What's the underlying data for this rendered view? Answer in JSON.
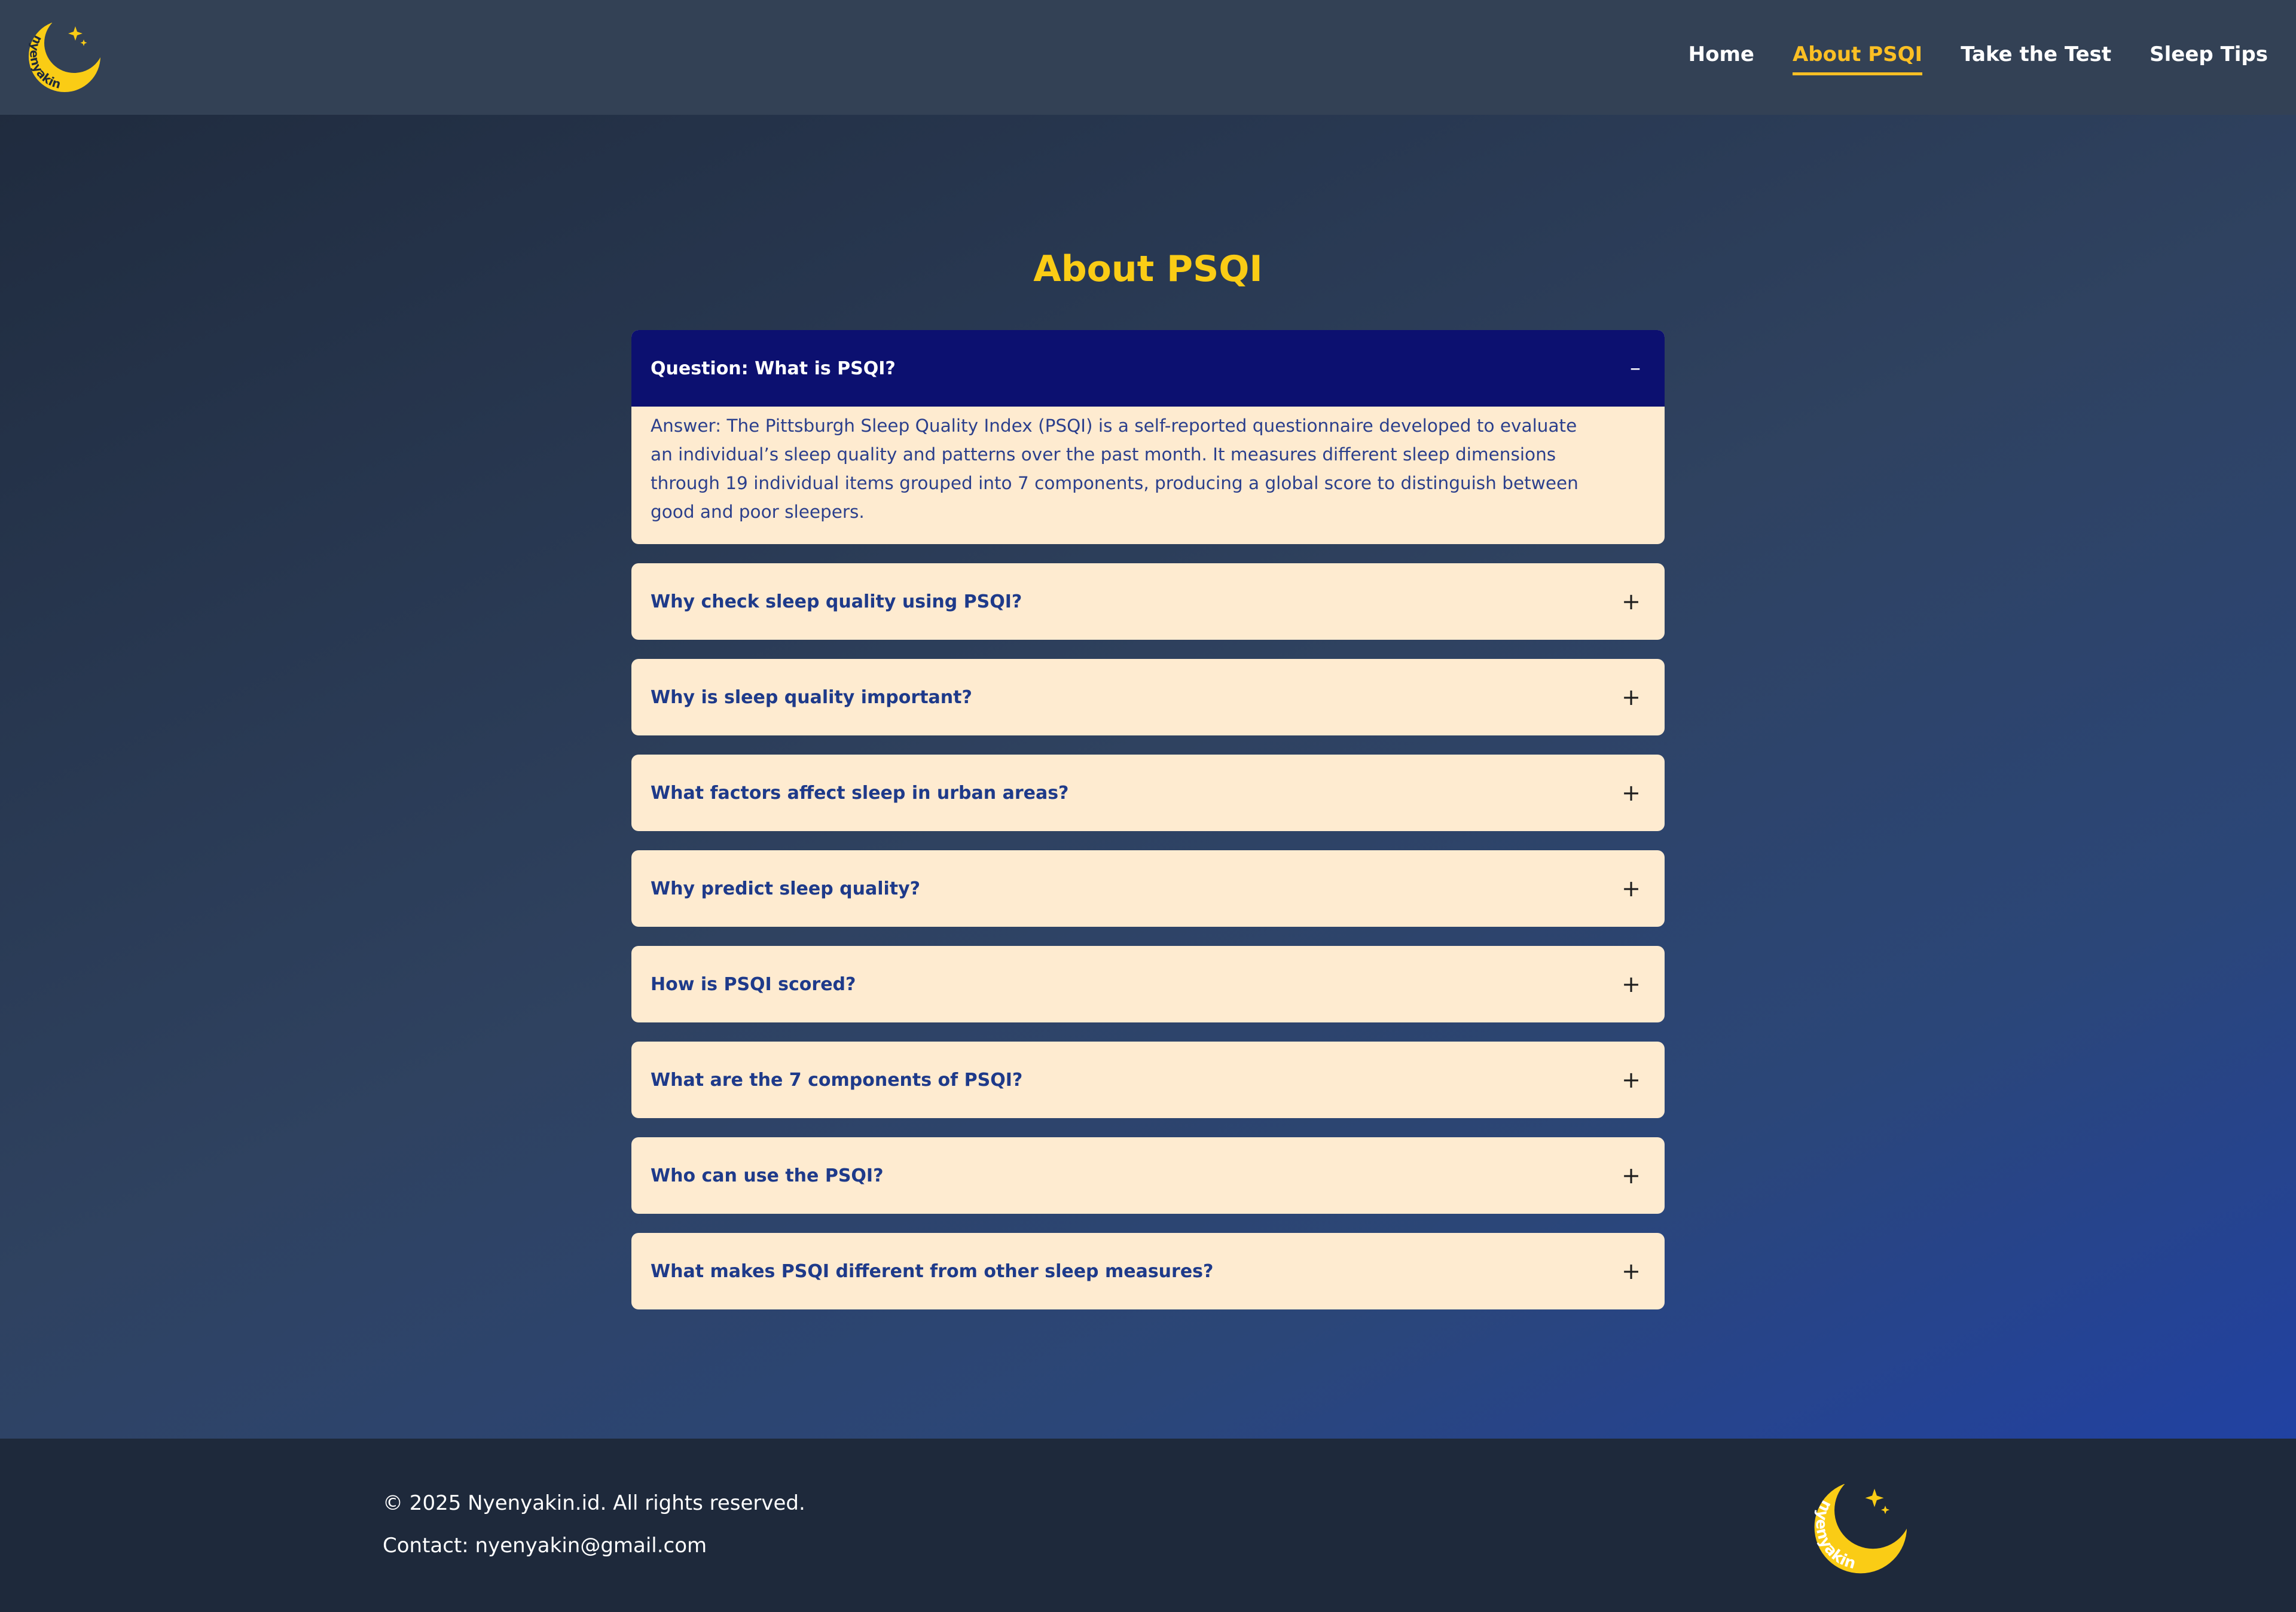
{
  "brand": {
    "logo_text": "nyenyakin",
    "colors": {
      "moon": "#facc15",
      "accent": "#fbbf24",
      "header_bg": "#334155",
      "footer_bg": "#1e293b",
      "faq_bg": "#feebd0",
      "faq_open_bg": "#0c1070"
    }
  },
  "nav": {
    "items": [
      {
        "label": "Home"
      },
      {
        "label": "About PSQI",
        "active": true
      },
      {
        "label": "Take the Test"
      },
      {
        "label": "Sleep Tips"
      }
    ]
  },
  "main": {
    "title": "About PSQI",
    "faq": [
      {
        "question": "Question: What is PSQI?",
        "toggle": "–",
        "open": true,
        "answer": "Answer: The Pittsburgh Sleep Quality Index (PSQI) is a self-reported questionnaire developed to evaluate an individual’s sleep quality and patterns over the past month. It measures different sleep dimensions through 19 individual items grouped into 7 components, producing a global score to distinguish between good and poor sleepers."
      },
      {
        "question": "Why check sleep quality using PSQI?",
        "toggle": "+"
      },
      {
        "question": "Why is sleep quality important?",
        "toggle": "+"
      },
      {
        "question": "What factors affect sleep in urban areas?",
        "toggle": "+"
      },
      {
        "question": "Why predict sleep quality?",
        "toggle": "+"
      },
      {
        "question": "How is PSQI scored?",
        "toggle": "+"
      },
      {
        "question": "What are the 7 components of PSQI?",
        "toggle": "+"
      },
      {
        "question": "Who can use the PSQI?",
        "toggle": "+"
      },
      {
        "question": "What makes PSQI different from other sleep measures?",
        "toggle": "+"
      }
    ]
  },
  "footer": {
    "copyright": "© 2025 Nyenyakin.id. All rights reserved.",
    "contact": "Contact: nyenyakin@gmail.com"
  }
}
